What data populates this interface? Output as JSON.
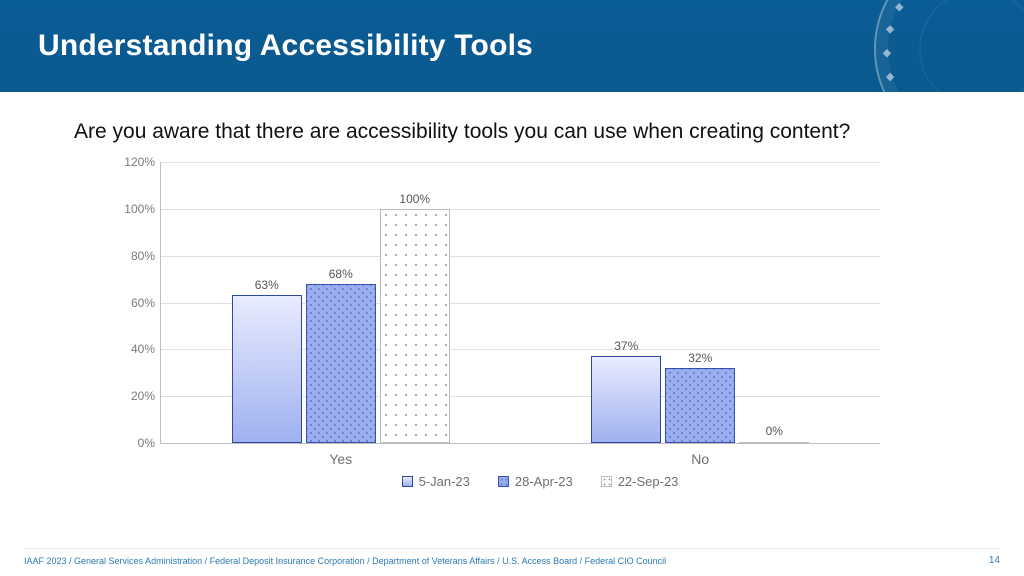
{
  "header": {
    "title": "Understanding Accessibility Tools"
  },
  "question": "Are you aware that there are accessibility tools you can use when creating content?",
  "chart_data": {
    "type": "bar",
    "categories": [
      "Yes",
      "No"
    ],
    "series": [
      {
        "name": "5-Jan-23",
        "values": [
          63,
          37
        ]
      },
      {
        "name": "28-Apr-23",
        "values": [
          68,
          32
        ]
      },
      {
        "name": "22-Sep-23",
        "values": [
          100,
          0
        ]
      }
    ],
    "ylabel": "",
    "xlabel": "",
    "ylim": [
      0,
      120
    ],
    "yticks": [
      0,
      20,
      40,
      60,
      80,
      100,
      120
    ],
    "value_suffix": "%"
  },
  "legend": [
    "5-Jan-23",
    "28-Apr-23",
    "22-Sep-23"
  ],
  "footer": {
    "text": "IAAF 2023 / General Services Administration / Federal Deposit Insurance Corporation / Department of Veterans Affairs / U.S. Access Board / Federal CIO Council",
    "page": "14"
  }
}
